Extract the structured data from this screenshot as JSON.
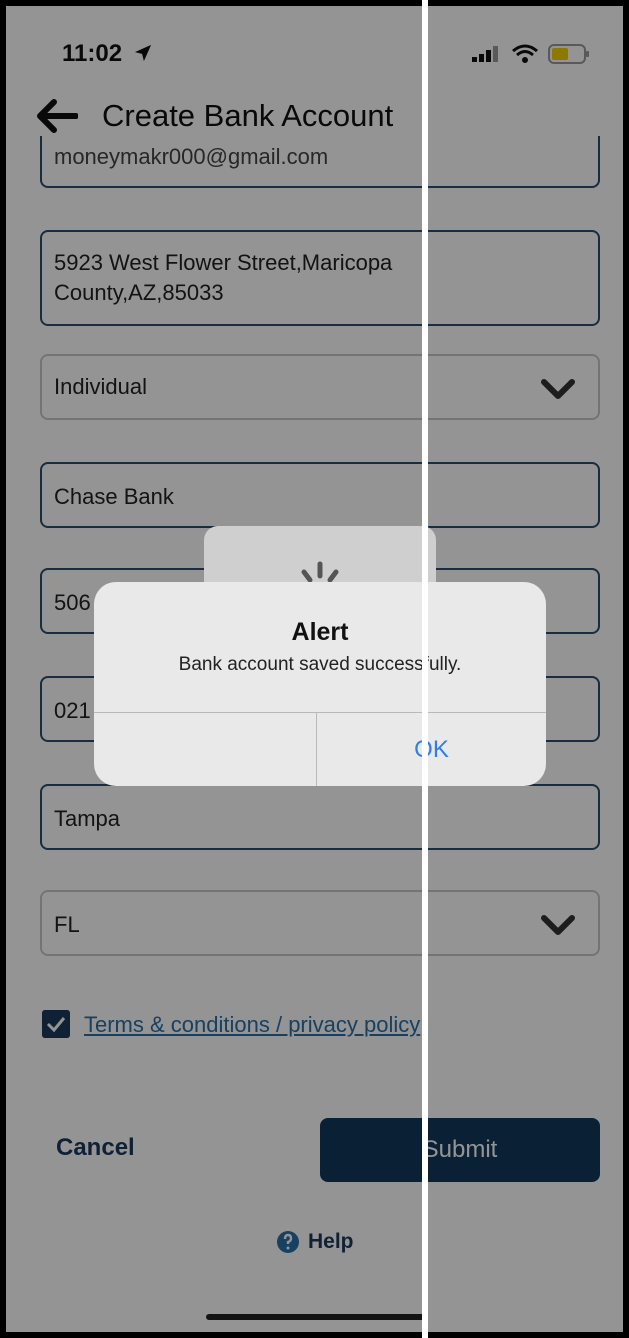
{
  "status_bar": {
    "time": "11:02"
  },
  "header": {
    "title": "Create Bank Account"
  },
  "form": {
    "email": "moneymakr000@gmail.com",
    "address": "5923 West Flower Street,Maricopa County,AZ,85033",
    "account_type": "Individual",
    "bank_name": "Chase Bank",
    "account_number_partial": "506",
    "routing_number_partial": "021",
    "city": "Tampa",
    "state": "FL",
    "terms_checked": true,
    "terms_label": "Terms & conditions / privacy policy"
  },
  "actions": {
    "cancel_label": "Cancel",
    "submit_label": "Submit",
    "help_label": "Help"
  },
  "alert": {
    "title": "Alert",
    "message": "Bank account saved successfully.",
    "ok_label": "OK"
  },
  "colors": {
    "primary": "#123a5c",
    "link": "#2a6ea8",
    "alert_button": "#2f7fe6"
  }
}
